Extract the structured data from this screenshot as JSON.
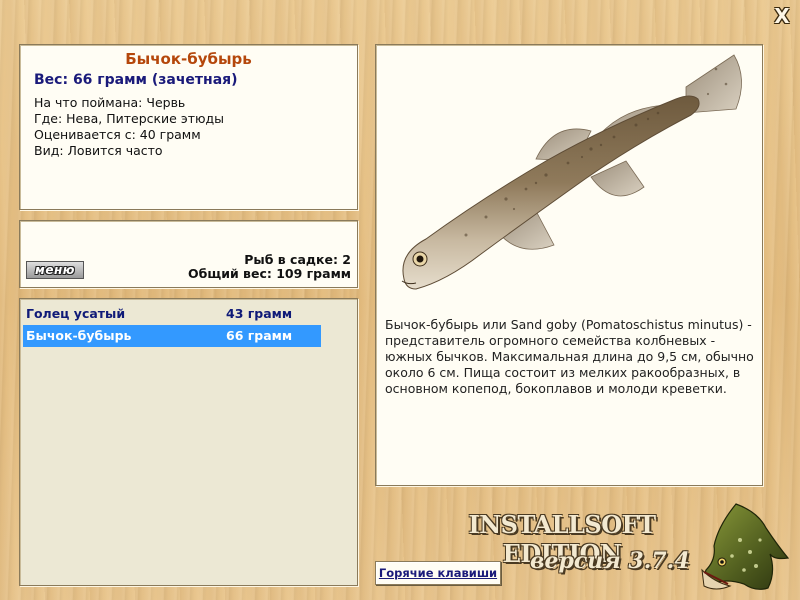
{
  "window": {
    "close_label": "X"
  },
  "info": {
    "title": "Бычок-бубырь",
    "weight": "Вес: 66 грамм (зачетная)",
    "bait": "На что поймана: Червь",
    "location": "Где: Нева, Питерские этюды",
    "min_weight": "Оценивается с: 40 грамм",
    "frequency": "Вид: Ловится часто"
  },
  "stats": {
    "menu_label": "меню",
    "fish_count": "Рыб в садке: 2",
    "total_weight": "Общий вес: 109 грамм"
  },
  "catch_list": [
    {
      "name": "Голец усатый",
      "weight": "43 грамм",
      "selected": false
    },
    {
      "name": "Бычок-бубырь",
      "weight": "66 грамм",
      "selected": true
    }
  ],
  "description": "Бычок-бубырь или Sand goby (Pomatoschistus minutus) - представитель огромного семейства колбневых - южных бычков. Максимальная длина до 9,5 см, обычно около 6 см. Пища состоит из мелких ракообразных, в основном копепод, бокоплавов и молоди креветки.",
  "footer": {
    "hotkeys_label": "Горячие клавиши",
    "brand": "INSTALLSOFT EDITION",
    "version": "версия 3.7.4"
  }
}
